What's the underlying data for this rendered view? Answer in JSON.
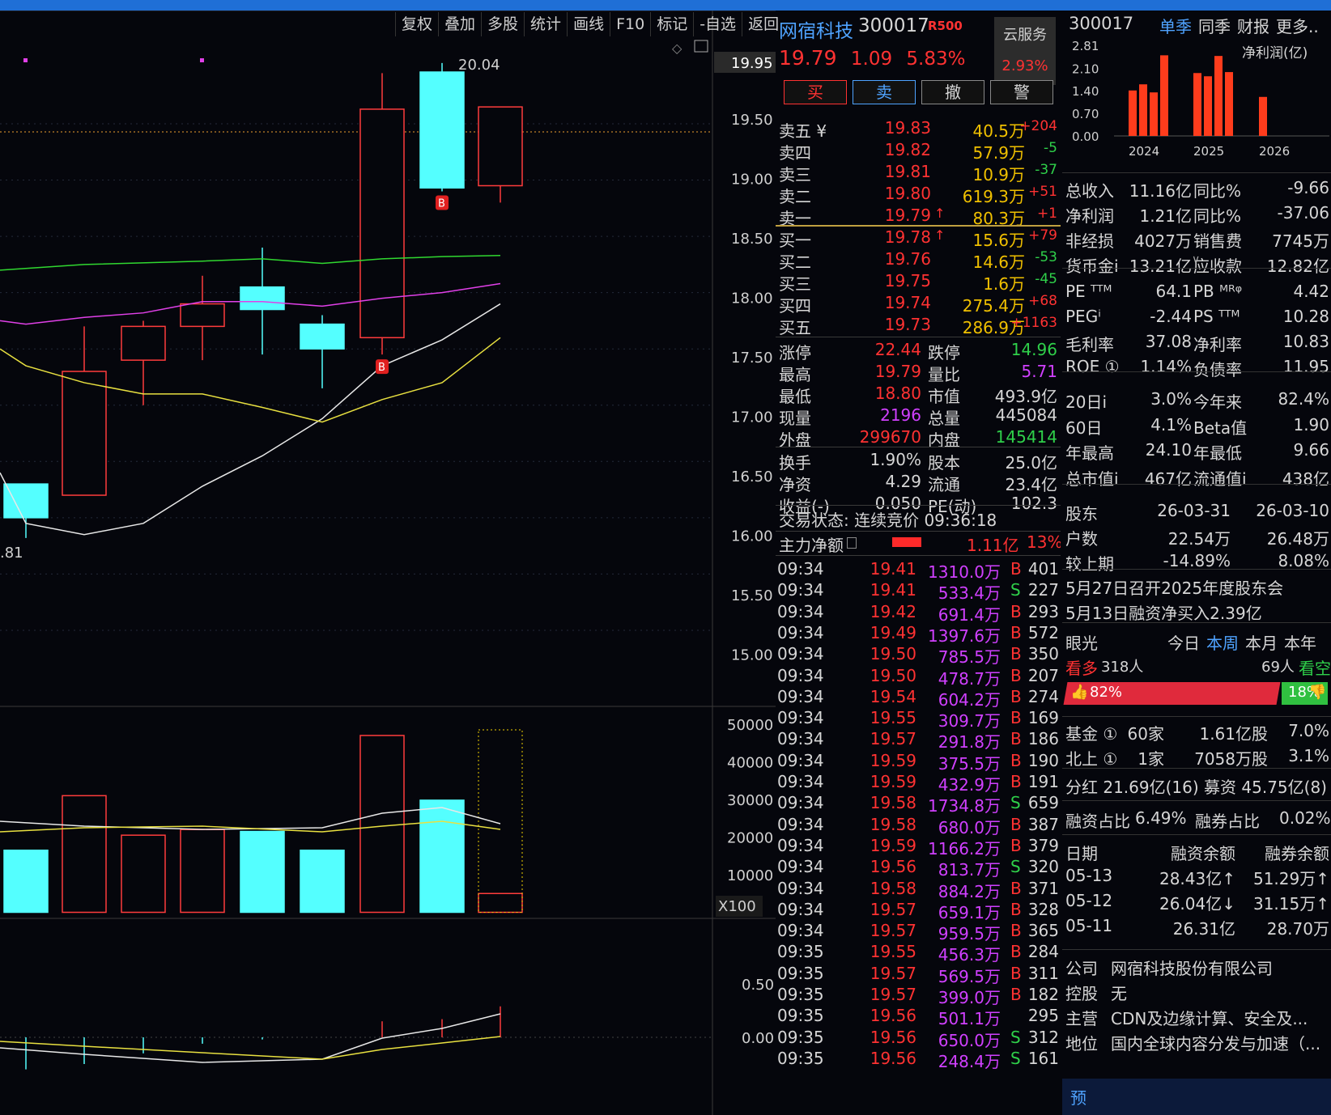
{
  "toolbar": [
    "复权",
    "叠加",
    "多股",
    "统计",
    "画线",
    "F10",
    "标记",
    "-自选",
    "返回"
  ],
  "chart": {
    "price_axis": [
      "19.95",
      "19.50",
      "19.00",
      "18.50",
      "18.00",
      "17.50",
      "17.00",
      "16.50",
      "16.00",
      "15.50",
      "15.00"
    ],
    "high_label": "20.04",
    "low_label": ".81",
    "vol_axis": [
      "50000",
      "40000",
      "30000",
      "20000",
      "10000"
    ],
    "vol_unit": "X100",
    "ind_axis": [
      "0.50",
      "0.00"
    ],
    "signal_label": "B"
  },
  "stock": {
    "name": "网宿科技",
    "code": "300017",
    "badge": "R500",
    "price": "19.79",
    "change": "1.09",
    "change_pct": "5.83%",
    "cloud_label": "云服务",
    "cloud_pct": "2.93%"
  },
  "trade_buttons": {
    "buy": "买",
    "sell": "卖",
    "cancel": "撤",
    "alert": "警"
  },
  "order_book": {
    "asks": [
      {
        "label": "卖五 ¥",
        "price": "19.83",
        "vol": "40.5万",
        "chg": "+204"
      },
      {
        "label": "卖四",
        "price": "19.82",
        "vol": "57.9万",
        "chg": "-5"
      },
      {
        "label": "卖三",
        "price": "19.81",
        "vol": "10.9万",
        "chg": "-37"
      },
      {
        "label": "卖二",
        "price": "19.80",
        "vol": "619.3万",
        "chg": "+51"
      },
      {
        "label": "卖一",
        "price": "19.79",
        "vol": "80.3万",
        "chg": "+1"
      }
    ],
    "bids": [
      {
        "label": "买一",
        "price": "19.78",
        "vol": "15.6万",
        "chg": "+79"
      },
      {
        "label": "买二",
        "price": "19.76",
        "vol": "14.6万",
        "chg": "-53"
      },
      {
        "label": "买三",
        "price": "19.75",
        "vol": "1.6万",
        "chg": "-45"
      },
      {
        "label": "买四",
        "price": "19.74",
        "vol": "275.4万",
        "chg": "+68"
      },
      {
        "label": "买五",
        "price": "19.73",
        "vol": "286.9万",
        "chg": "+1163"
      }
    ]
  },
  "stats1": [
    {
      "l1": "涨停",
      "v1": "22.44",
      "l2": "跌停",
      "v2": "14.96"
    },
    {
      "l1": "最高",
      "v1": "19.79",
      "l2": "量比",
      "v2": "5.71"
    },
    {
      "l1": "最低",
      "v1": "18.80",
      "l2": "市值",
      "v2": "493.9亿"
    },
    {
      "l1": "现量",
      "v1": "2196",
      "l2": "总量",
      "v2": "445084"
    },
    {
      "l1": "外盘",
      "v1": "299670",
      "l2": "内盘",
      "v2": "145414"
    }
  ],
  "stats2": [
    {
      "l1": "换手",
      "v1": "1.90%",
      "l2": "股本",
      "v2": "25.0亿"
    },
    {
      "l1": "净资",
      "v1": "4.29",
      "l2": "流通",
      "v2": "23.4亿"
    },
    {
      "l1": "收益(-)",
      "v1": "0.050",
      "l2": "PE(动)",
      "v2": "102.3"
    }
  ],
  "trade_status": "交易状态: 连续竞价 09:36:18",
  "main_flow": {
    "label": "主力净额",
    "value": "1.11亿",
    "pct": "13%"
  },
  "ticks": [
    {
      "t": "09:34",
      "p": "19.41",
      "v": "1310.0万",
      "s": "B",
      "n": "401"
    },
    {
      "t": "09:34",
      "p": "19.41",
      "v": "533.4万",
      "s": "S",
      "n": "227"
    },
    {
      "t": "09:34",
      "p": "19.42",
      "v": "691.4万",
      "s": "B",
      "n": "293"
    },
    {
      "t": "09:34",
      "p": "19.49",
      "v": "1397.6万",
      "s": "B",
      "n": "572"
    },
    {
      "t": "09:34",
      "p": "19.50",
      "v": "785.5万",
      "s": "B",
      "n": "350"
    },
    {
      "t": "09:34",
      "p": "19.50",
      "v": "478.7万",
      "s": "B",
      "n": "207"
    },
    {
      "t": "09:34",
      "p": "19.54",
      "v": "604.2万",
      "s": "B",
      "n": "274"
    },
    {
      "t": "09:34",
      "p": "19.55",
      "v": "309.7万",
      "s": "B",
      "n": "169"
    },
    {
      "t": "09:34",
      "p": "19.57",
      "v": "291.8万",
      "s": "B",
      "n": "186"
    },
    {
      "t": "09:34",
      "p": "19.59",
      "v": "375.5万",
      "s": "B",
      "n": "190"
    },
    {
      "t": "09:34",
      "p": "19.59",
      "v": "432.9万",
      "s": "B",
      "n": "191"
    },
    {
      "t": "09:34",
      "p": "19.58",
      "v": "1734.8万",
      "s": "S",
      "n": "659"
    },
    {
      "t": "09:34",
      "p": "19.58",
      "v": "680.0万",
      "s": "B",
      "n": "387"
    },
    {
      "t": "09:34",
      "p": "19.59",
      "v": "1166.2万",
      "s": "B",
      "n": "379"
    },
    {
      "t": "09:34",
      "p": "19.56",
      "v": "813.7万",
      "s": "S",
      "n": "320"
    },
    {
      "t": "09:34",
      "p": "19.58",
      "v": "884.2万",
      "s": "B",
      "n": "371"
    },
    {
      "t": "09:34",
      "p": "19.57",
      "v": "659.1万",
      "s": "B",
      "n": "328"
    },
    {
      "t": "09:34",
      "p": "19.57",
      "v": "959.5万",
      "s": "B",
      "n": "365"
    },
    {
      "t": "09:35",
      "p": "19.55",
      "v": "456.3万",
      "s": "B",
      "n": "284"
    },
    {
      "t": "09:35",
      "p": "19.57",
      "v": "569.5万",
      "s": "B",
      "n": "311"
    },
    {
      "t": "09:35",
      "p": "19.57",
      "v": "399.0万",
      "s": "B",
      "n": "182"
    },
    {
      "t": "09:35",
      "p": "19.56",
      "v": "501.1万",
      "s": "",
      "n": "295"
    },
    {
      "t": "09:35",
      "p": "19.56",
      "v": "650.0万",
      "s": "S",
      "n": "312"
    },
    {
      "t": "09:35",
      "p": "19.56",
      "v": "248.4万",
      "s": "S",
      "n": "161"
    }
  ],
  "fin": {
    "code": "300017",
    "tabs": [
      "单季",
      "同季",
      "财报",
      "更多.."
    ],
    "chart_title": "净利润(亿)",
    "chart_data": {
      "type": "bar",
      "title": "净利润(亿)",
      "y_ticks": [
        "2.81",
        "2.10",
        "1.40",
        "0.70",
        "0.00"
      ],
      "x_labels": [
        "2024",
        "2025",
        "2026"
      ],
      "values": [
        1.41,
        1.6,
        1.35,
        2.5,
        1.95,
        1.85,
        2.48,
        1.98,
        1.21
      ],
      "ylim": [
        0,
        2.81
      ]
    },
    "rows1": [
      {
        "l1": "总收入",
        "v1": "11.16亿",
        "l2": "同比%",
        "v2": "-9.66"
      },
      {
        "l1": "净利润",
        "v1": "1.21亿",
        "l2": "同比%",
        "v2": "-37.06"
      },
      {
        "l1": "非经损",
        "v1": "4027万",
        "l2": "销售费",
        "v2": "7745万"
      },
      {
        "l1": "货币金i",
        "v1": "13.21亿",
        "l2": "应收款",
        "v2": "12.82亿"
      }
    ],
    "rows2": [
      {
        "l1": "PE ᵀᵀᴹ",
        "v1": "64.1",
        "l2": "PB ᴹᴿᵠ",
        "v2": "4.42"
      },
      {
        "l1": "PEGⁱ",
        "v1": "-2.44",
        "l2": "PS ᵀᵀᴹ",
        "v2": "10.28"
      },
      {
        "l1": "毛利率",
        "v1": "37.08",
        "l2": "净利率",
        "v2": "10.83"
      },
      {
        "l1": "ROE ①",
        "v1": "1.14%",
        "l2": "负债率",
        "v2": "11.95"
      }
    ],
    "rows3": [
      {
        "l1": "20日i",
        "v1": "3.0%",
        "l2": "今年来",
        "v2": "82.4%"
      },
      {
        "l1": "60日",
        "v1": "4.1%",
        "l2": "Beta值",
        "v2": "1.90"
      },
      {
        "l1": "年最高",
        "v1": "24.10",
        "l2": "年最低",
        "v2": "9.66"
      },
      {
        "l1": "总市值i",
        "v1": "467亿",
        "l2": "流通值i",
        "v2": "438亿"
      }
    ],
    "holders": [
      {
        "l": "股东",
        "a": "26-03-31",
        "b": "26-03-10"
      },
      {
        "l": "户数",
        "a": "22.54万",
        "b": "26.48万"
      },
      {
        "l": "较上期",
        "a": "-14.89%",
        "b": "8.08%"
      }
    ],
    "news": [
      "5月27日召开2025年度股东会",
      "5月13日融资净买入2.39亿"
    ],
    "sentiment": {
      "label": "眼光",
      "tabs": [
        "今日",
        "本周",
        "本月",
        "本年"
      ],
      "bull_label": "看多",
      "bull_count": "318人",
      "bear_label": "看空",
      "bear_count": "69人",
      "bull_pct": "82%",
      "bear_pct": "18%",
      "bull_ratio": 0.82
    },
    "funds": [
      {
        "l": "基金 ①",
        "a": "60家",
        "b": "1.61亿股",
        "c": "7.0%"
      },
      {
        "l": "北上 ①",
        "a": "1家",
        "b": "7058万股",
        "c": "3.1%"
      }
    ],
    "dividend": "分红 21.69亿(16) 募资 45.75亿(8)",
    "margin_ratio": {
      "l1": "融资占比",
      "v1": "6.49%",
      "l2": "融券占比",
      "v2": "0.02%"
    },
    "margin_head": [
      "日期",
      "融资余额",
      "融券余额"
    ],
    "margin_rows": [
      {
        "d": "05-13",
        "a": "28.43亿↑",
        "b": "51.29万↑"
      },
      {
        "d": "05-12",
        "a": "26.04亿↓",
        "b": "31.15万↑"
      },
      {
        "d": "05-11",
        "a": "26.31亿",
        "b": "28.70万"
      }
    ],
    "company": [
      {
        "l": "公司",
        "v": "网宿科技股份有限公司"
      },
      {
        "l": "控股",
        "v": "无"
      },
      {
        "l": "主营",
        "v": "CDN及边缘计算、安全及..."
      },
      {
        "l": "地位",
        "v": "国内全球内容分发与加速（..."
      }
    ],
    "bottom_tag": "预"
  }
}
